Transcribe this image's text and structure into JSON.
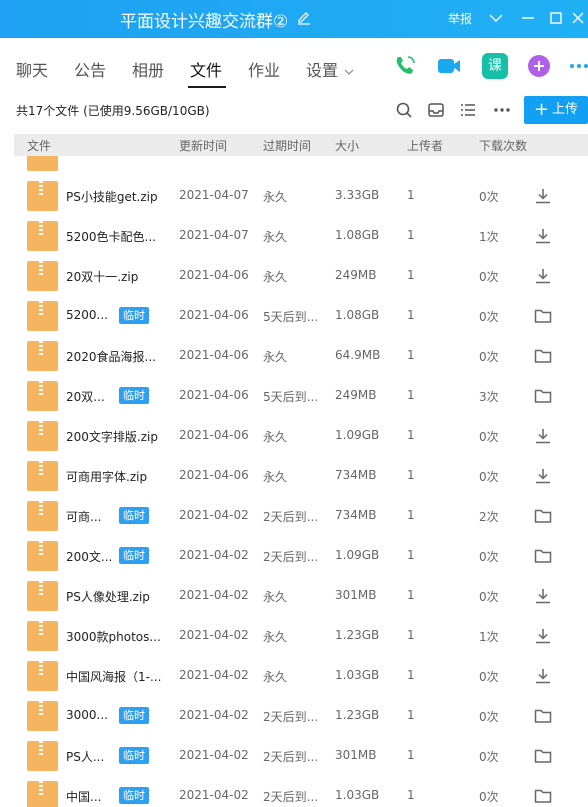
{
  "window": {
    "title": "平面设计兴趣交流群②",
    "report": "举报",
    "icons": [
      "edit-icon",
      "chevron-down-icon",
      "minimize-icon",
      "maximize-icon",
      "close-icon"
    ]
  },
  "tabs": [
    {
      "label": "聊天"
    },
    {
      "label": "公告"
    },
    {
      "label": "相册"
    },
    {
      "label": "文件",
      "active": true
    },
    {
      "label": "作业"
    },
    {
      "label": "设置"
    }
  ],
  "app_icons": [
    "phone-icon",
    "video-icon",
    "course-icon",
    "add-app-icon",
    "more-icon"
  ],
  "summary": {
    "text": "共17个文件 (已使用9.56GB/10GB)",
    "upload_label": "上传",
    "tools": [
      "search-icon",
      "inbox-icon",
      "list-view-icon",
      "more-icon"
    ]
  },
  "columns": {
    "file": "文件",
    "updated": "更新时间",
    "expire": "过期时间",
    "size": "大小",
    "uploader": "上传者",
    "downloads": "下载次数"
  },
  "files": [
    {
      "name": "PS小技能get.zip",
      "temp": false,
      "date": "2021-04-07",
      "expire": "永久",
      "size": "3.33GB",
      "uploader": "1",
      "downloads": "0次",
      "action": "download-icon"
    },
    {
      "name": "5200色卡配色...",
      "temp": false,
      "date": "2021-04-07",
      "expire": "永久",
      "size": "1.08GB",
      "uploader": "1",
      "downloads": "1次",
      "action": "download-icon"
    },
    {
      "name": "20双十一.zip",
      "temp": false,
      "date": "2021-04-06",
      "expire": "永久",
      "size": "249MB",
      "uploader": "1",
      "downloads": "0次",
      "action": "download-icon"
    },
    {
      "name": "5200...",
      "temp": true,
      "date": "2021-04-06",
      "expire": "5天后到...",
      "size": "1.08GB",
      "uploader": "1",
      "downloads": "0次",
      "action": "folder-icon"
    },
    {
      "name": "2020食品海报...",
      "temp": false,
      "date": "2021-04-06",
      "expire": "永久",
      "size": "64.9MB",
      "uploader": "1",
      "downloads": "0次",
      "action": "folder-icon"
    },
    {
      "name": "20双...",
      "temp": true,
      "date": "2021-04-06",
      "expire": "5天后到...",
      "size": "249MB",
      "uploader": "1",
      "downloads": "3次",
      "action": "folder-icon"
    },
    {
      "name": "200文字排版.zip",
      "temp": false,
      "date": "2021-04-06",
      "expire": "永久",
      "size": "1.09GB",
      "uploader": "1",
      "downloads": "0次",
      "action": "download-icon"
    },
    {
      "name": "可商用字体.zip",
      "temp": false,
      "date": "2021-04-06",
      "expire": "永久",
      "size": "734MB",
      "uploader": "1",
      "downloads": "0次",
      "action": "download-icon"
    },
    {
      "name": "可商...",
      "temp": true,
      "date": "2021-04-02",
      "expire": "2天后到...",
      "size": "734MB",
      "uploader": "1",
      "downloads": "2次",
      "action": "folder-icon"
    },
    {
      "name": "200文...",
      "temp": true,
      "date": "2021-04-02",
      "expire": "2天后到...",
      "size": "1.09GB",
      "uploader": "1",
      "downloads": "0次",
      "action": "folder-icon"
    },
    {
      "name": "PS人像处理.zip",
      "temp": false,
      "date": "2021-04-02",
      "expire": "永久",
      "size": "301MB",
      "uploader": "1",
      "downloads": "0次",
      "action": "download-icon"
    },
    {
      "name": "3000款photos...",
      "temp": false,
      "date": "2021-04-02",
      "expire": "永久",
      "size": "1.23GB",
      "uploader": "1",
      "downloads": "1次",
      "action": "download-icon"
    },
    {
      "name": "中国风海报（1-...",
      "temp": false,
      "date": "2021-04-02",
      "expire": "永久",
      "size": "1.03GB",
      "uploader": "1",
      "downloads": "0次",
      "action": "download-icon"
    },
    {
      "name": "3000...",
      "temp": true,
      "date": "2021-04-02",
      "expire": "2天后到...",
      "size": "1.23GB",
      "uploader": "1",
      "downloads": "0次",
      "action": "folder-icon"
    },
    {
      "name": "PS人...",
      "temp": true,
      "date": "2021-04-02",
      "expire": "2天后到...",
      "size": "301MB",
      "uploader": "1",
      "downloads": "0次",
      "action": "folder-icon"
    },
    {
      "name": "中国...",
      "temp": true,
      "date": "2021-04-02",
      "expire": "2天后到...",
      "size": "1.03GB",
      "uploader": "1",
      "downloads": "0次",
      "action": "folder-icon"
    }
  ],
  "temp_tag": "临时",
  "colors": {
    "titlebar": "#1ea1f2",
    "accent": "#13a0f2",
    "file_icon": "#f5b45f",
    "header_bg": "#ebebeb"
  }
}
